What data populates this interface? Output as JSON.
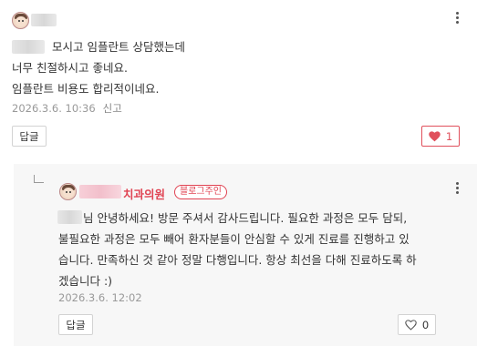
{
  "comment": {
    "text_line1_suffix": "모시고 임플란트 상담했는데",
    "text_line2": "너무 친절하시고 좋네요.",
    "text_line3": "임플란트 비용도 합리적이네요.",
    "timestamp": "2026.3.6. 10:36",
    "report_label": "신고",
    "reply_button": "답글",
    "like_icon": "heart-icon",
    "like_count": "1",
    "liked": true,
    "accent_color": "#e0505c"
  },
  "reply": {
    "clinic_name": "치과의원",
    "owner_badge": "블로그주인",
    "line1_suffix": "님 안녕하세요! 방문 주셔서 감사드립니다. 필요한 과정은 모두 담되,",
    "line2": "불필요한 과정은 모두 빼어 환자분들이 안심할 수 있게 진료를 진행하고 있",
    "line3": "습니다. 만족하신 것 같아 정말 다행입니다. 항상 최선을 다해 진료하도록 하",
    "line4": "겠습니다 :)",
    "timestamp": "2026.3.6. 12:02",
    "reply_button": "답글",
    "like_icon": "heart-outline-icon",
    "like_count": "0",
    "accent_color": "#e04352"
  }
}
